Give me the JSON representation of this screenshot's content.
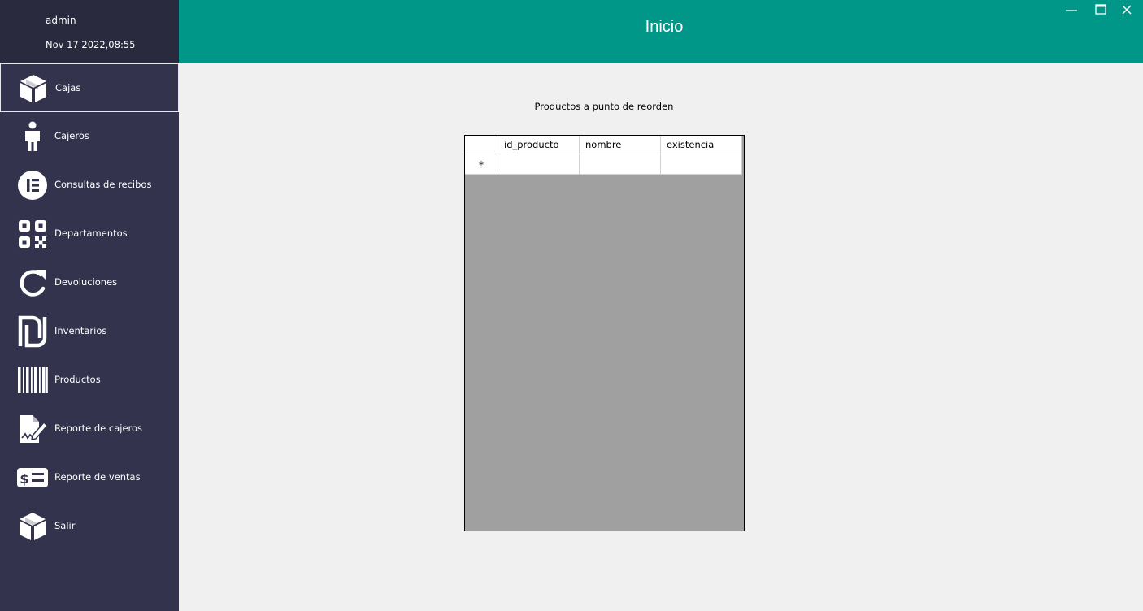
{
  "user": {
    "name": "admin",
    "datetime": "Nov 17 2022,08:55"
  },
  "header": {
    "title": "Inicio"
  },
  "window_controls": {
    "minimize_icon": "minimize-icon",
    "maximize_icon": "maximize-icon",
    "close_icon": "close-icon"
  },
  "nav": {
    "items": [
      {
        "label": "Cajas",
        "icon": "box-icon",
        "active": true
      },
      {
        "label": "Cajeros",
        "icon": "person-icon"
      },
      {
        "label": "Consultas de recibos",
        "icon": "elementor-icon"
      },
      {
        "label": "Departamentos",
        "icon": "qr-code-icon"
      },
      {
        "label": "Devoluciones",
        "icon": "refresh-icon"
      },
      {
        "label": "Inventarios",
        "icon": "shekel-icon"
      },
      {
        "label": "Productos",
        "icon": "barcode-icon"
      },
      {
        "label": "Reporte de cajeros",
        "icon": "signature-icon"
      },
      {
        "label": "Reporte de ventas",
        "icon": "money-check-icon"
      },
      {
        "label": "Salir",
        "icon": "box-icon"
      }
    ]
  },
  "content": {
    "title": "Productos a punto de reorden",
    "grid": {
      "columns": [
        "id_producto",
        "nombre",
        "existencia"
      ],
      "new_row_marker": "*",
      "rows": []
    }
  },
  "colors": {
    "sidebar": "#33334d",
    "sidebar_top": "#2a2a3e",
    "header": "#009688",
    "content_bg": "#f0f0f0",
    "grid_bg": "#a0a0a0"
  }
}
